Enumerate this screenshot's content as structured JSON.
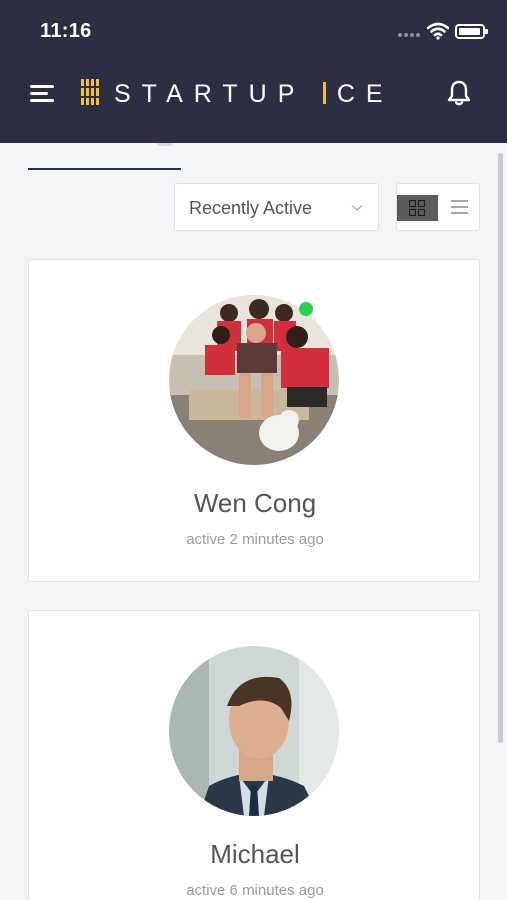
{
  "status_bar": {
    "time": "11:16"
  },
  "header": {
    "brand_text": "STARTUP",
    "brand_text_suffix": "CE",
    "icons": {
      "menu": "hamburger-icon",
      "logo": "startup-ice-logo",
      "notifications": "bell-icon"
    },
    "colors": {
      "background": "#2c2f43",
      "accent": "#f2c230"
    }
  },
  "filters": {
    "sort_selected": "Recently Active",
    "view_mode": "grid"
  },
  "members": [
    {
      "name": "Wen Cong",
      "last_active": "active 2 minutes ago",
      "online": true,
      "avatar": "family-group-photo"
    },
    {
      "name": "Michael",
      "last_active": "active 6 minutes ago",
      "online": false,
      "avatar": "businessman-portrait"
    }
  ],
  "colors": {
    "online": "#2bd24d",
    "page_bg": "#f4f5f7"
  }
}
